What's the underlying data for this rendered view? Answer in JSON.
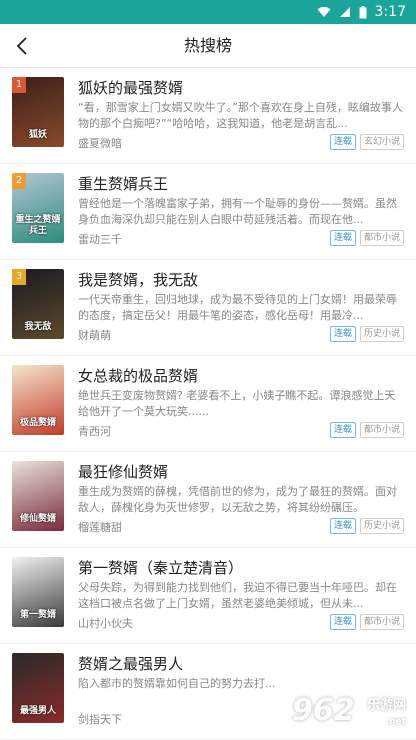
{
  "status_bar": {
    "time": "3:17",
    "background": "#1aa59a"
  },
  "header": {
    "title": "热搜榜",
    "back_icon": "chevron-left-icon"
  },
  "books": [
    {
      "rank": "1",
      "title": "狐妖的最强赘婿",
      "desc": "“看，那雪家上门女婿又吹牛了。”那个喜欢在身上自残，眩编故事人物的那个白痴吧?”“哈哈哈，这我知道，他老是胡言乱...",
      "author": "盛夏微暗",
      "status": "连载",
      "genre": "玄幻小说",
      "cover_text": "狐妖",
      "cover_colors": [
        "#3a1f1a",
        "#8a4a2a"
      ],
      "rank_color": "#e85c3a"
    },
    {
      "rank": "2",
      "title": "重生赘婿兵王",
      "desc": "曾经他是一个落魄富家子弟，拥有一个耻辱的身份——赘婿。虽然身负血海深仇却只能在别人白眼中苟延残活着。而现在他...",
      "author": "雷动三千",
      "status": "连载",
      "genre": "都市小说",
      "cover_text": "重生之赘婿兵王",
      "cover_colors": [
        "#b4c6d6",
        "#2c8c7c"
      ],
      "rank_color": "#f39a2a"
    },
    {
      "rank": "3",
      "title": "我是赘婿，我无敌",
      "desc": "一代天帝重生，回归地球，成为最不受待见的上门女婿！用最荣辱的态度，搞定岳父！用最牛笔的姿态，感化岳母！用最冷...",
      "author": "财萌萌",
      "status": "连载",
      "genre": "历史小说",
      "cover_text": "我无敌",
      "cover_colors": [
        "#1a1a22",
        "#5a4a2a"
      ],
      "rank_color": "#f5b62a"
    },
    {
      "rank": "",
      "title": "女总裁的极品赘婿",
      "desc": "绝世兵王变废物赘婿? 老婆看不上，小姨子瞧不起。谭浪感觉上天给他开了一个莫大玩笑......",
      "author": "青西河",
      "status": "连载",
      "genre": "都市小说",
      "cover_text": "极品赘婿",
      "cover_colors": [
        "#f4e6cc",
        "#c23a2a"
      ],
      "rank_color": ""
    },
    {
      "rank": "",
      "title": "最狂修仙赘婿",
      "desc": "重生成为赘婿的薛槐，凭借前世的修为，成为了最狂的赘婿。面对敌人，薛槐化身为灭世修罗，以无敌之势，将其纷纷碾压。",
      "author": "榴莲糖甜",
      "status": "连载",
      "genre": "历史小说",
      "cover_text": "修仙赘婿",
      "cover_colors": [
        "#e9e2dc",
        "#7a2a3a"
      ],
      "rank_color": ""
    },
    {
      "rank": "",
      "title": "第一赘婿（秦立楚清音）",
      "desc": "父母失踪，为得到能力找到他们，我迫不得已要当十年哑巴。却在这档口被点名做了上门女婿，虽然老婆绝美倾城，但从未...",
      "author": "山村小伙夫",
      "status": "连载",
      "genre": "都市小说",
      "cover_text": "第一赘婿",
      "cover_colors": [
        "#f2f2f2",
        "#3a3a3a"
      ],
      "rank_color": ""
    },
    {
      "rank": "",
      "title": "赘婿之最强男人",
      "desc": "陷入都市的赘婿靠如何自己的努力去打...",
      "author": "剑指天下",
      "status": "",
      "genre": "",
      "cover_text": "最强男人",
      "cover_colors": [
        "#2a2a2a",
        "#8a2a2a"
      ],
      "rank_color": ""
    }
  ],
  "watermark": {
    "main": "962",
    "sub": "乐游网",
    "url": ".net"
  }
}
